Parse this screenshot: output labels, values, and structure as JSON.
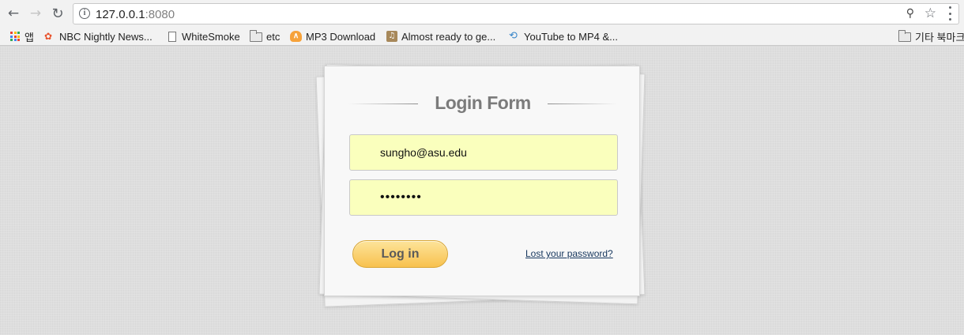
{
  "browser": {
    "url_host": "127.0.0.1",
    "url_port": ":8080",
    "bookmarks": [
      {
        "label": "앱",
        "icon": "apps-grid-icon"
      },
      {
        "label": "NBC Nightly News...",
        "icon": "nbc-peacock-icon"
      },
      {
        "label": "WhiteSmoke",
        "icon": "document-icon"
      },
      {
        "label": "etc",
        "icon": "folder-icon"
      },
      {
        "label": "MP3 Download",
        "icon": "mp3-icon"
      },
      {
        "label": "Almost ready to ge...",
        "icon": "music-note-icon"
      },
      {
        "label": "YouTube to MP4 &...",
        "icon": "swirl-icon"
      }
    ],
    "other_bookmarks": "기타 북마크"
  },
  "login": {
    "title": "Login Form",
    "email_value": "sungho@asu.edu",
    "password_value": "••••••••",
    "login_button": "Log in",
    "lost_password": "Lost your password?"
  },
  "colors": {
    "field_autofill": "#faffbd",
    "button_top": "#fde49a",
    "button_bottom": "#f8c14e",
    "link": "#17375e",
    "page_bg": "#dedede"
  }
}
